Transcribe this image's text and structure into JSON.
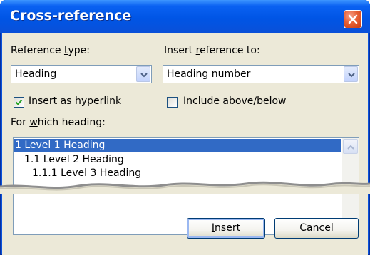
{
  "dialog": {
    "title": "Cross-reference",
    "close_icon": "close-icon"
  },
  "reference_type": {
    "label_pre": "Reference ",
    "label_key": "t",
    "label_post": "ype:",
    "value": "Heading"
  },
  "insert_reference_to": {
    "label_pre": "Insert ",
    "label_key": "r",
    "label_post": "eference to:",
    "value": "Heading number"
  },
  "insert_as_hyperlink": {
    "label_pre": "Insert as ",
    "label_key": "h",
    "label_post": "yperlink",
    "checked": true
  },
  "include_above_below": {
    "label_pre": "",
    "label_key": "I",
    "label_post": "nclude above/below",
    "checked": false
  },
  "for_which_heading": {
    "label_pre": "For ",
    "label_key": "w",
    "label_post": "hich heading:",
    "items": [
      "1 Level 1 Heading",
      "1.1 Level 2 Heading",
      "1.1.1 Level 3 Heading"
    ],
    "selected_index": 0
  },
  "buttons": {
    "insert_key": "I",
    "insert_rest": "nsert",
    "cancel": "Cancel"
  },
  "colors": {
    "title_bar": "#0055e5",
    "selection": "#316ac5",
    "dialog_face": "#ece9d8"
  }
}
